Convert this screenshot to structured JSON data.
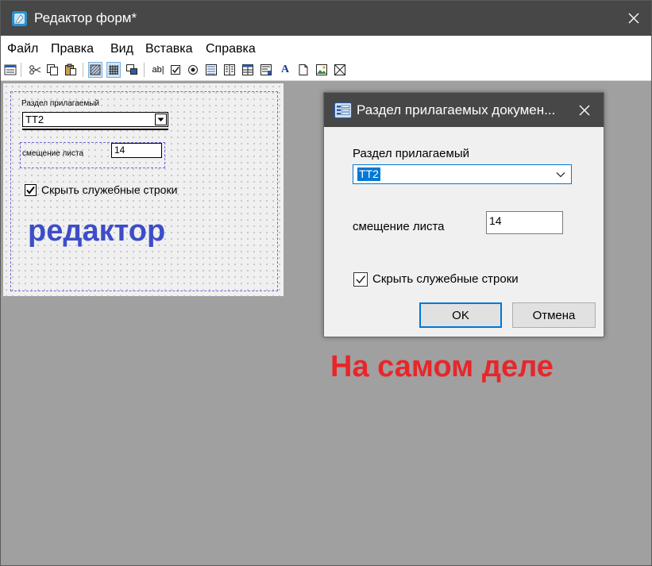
{
  "window": {
    "title": "Редактор форм*"
  },
  "menu": {
    "items": [
      "Файл",
      "Правка",
      "Вид",
      "Вставка",
      "Справка"
    ]
  },
  "toolbar": {
    "buttons": [
      "window-icon",
      "cut-icon",
      "copy-icon",
      "paste-icon",
      "shaded-grid-icon",
      "grid-icon",
      "overlap-icon",
      "text-field-icon",
      "checkbox-icon",
      "radio-icon",
      "list-icon",
      "columns-icon",
      "table-icon",
      "text-icon",
      "page-icon",
      "picture-icon",
      "box-icon"
    ],
    "text_field_glyph": "ab|",
    "text_glyph": "A"
  },
  "editor": {
    "label_section": "Раздел прилагаемый",
    "combo_value": "ТТ2",
    "label_offset": "смещение листа",
    "offset_value": "14",
    "checkbox_label": "Скрыть служебные строки",
    "checkbox_checked": true,
    "annotation": "редактор"
  },
  "dialog": {
    "title": "Раздел прилагаемых докумен...",
    "label_section": "Раздел прилагаемый",
    "combo_value": "ТТ2",
    "label_offset": "смещение листа",
    "offset_value": "14",
    "checkbox_label": "Скрыть служебные строки",
    "checkbox_checked": true,
    "ok_label": "OK",
    "cancel_label": "Отмена"
  },
  "annotation_real": "На самом деле",
  "colors": {
    "titlebar": "#474747",
    "workspace": "#a0a0a0",
    "accent": "#0078d7",
    "editor_annotation": "#3d4dc9",
    "real_annotation": "#e8262a"
  }
}
